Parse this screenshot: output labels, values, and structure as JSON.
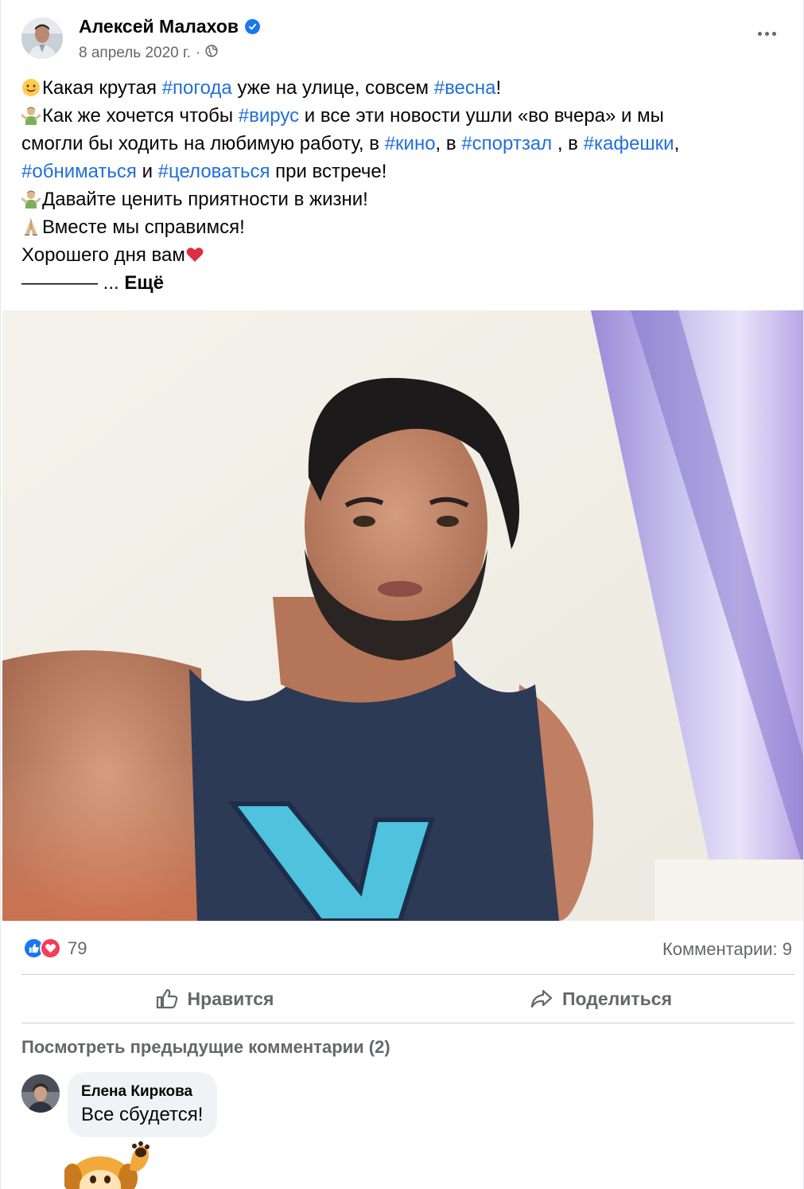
{
  "post": {
    "author": "Алексей Малахов",
    "date": "8 апрель 2020 г.",
    "separator": "·",
    "lines": {
      "l1a": "Какая крутая ",
      "l1_tag1": "#погода",
      "l1b": " уже на улице, совсем ",
      "l1_tag2": "#весна",
      "l1c": "!",
      "l2a": "Как же хочется чтобы ",
      "l2_tag": "#вирус",
      "l2b": " и все эти новости ушли «во вчера» и мы",
      "l3a": "смогли бы ходить на любимую работу, в ",
      "l3_tag1": "#кино",
      "l3b": ", в ",
      "l3_tag2": "#спортзал",
      "l3c": " , в ",
      "l3_tag3": "#кафешки",
      "l3d": ",",
      "l4_tag1": "#обниматься",
      "l4a": " и ",
      "l4_tag2": "#целоваться",
      "l4b": " при встрече!",
      "l5": "Давайте ценить приятности в жизни!",
      "l6": "Вместе мы справимся!",
      "l7": "Хорошего дня вам",
      "l8": "———— ",
      "ellipsis": "... ",
      "more": "Ещё"
    }
  },
  "reactions": {
    "count": "79",
    "comments": "Комментарии: 9"
  },
  "actions": {
    "like": "Нравится",
    "share": "Поделиться"
  },
  "comments": {
    "view_previous": "Посмотреть предыдущие комментарии (2)",
    "items": [
      {
        "author": "Елена Киркова",
        "text": "Все сбудется!"
      }
    ]
  },
  "colors": {
    "hashtag": "#216fdb",
    "verified": "#1877f2",
    "like": "#1877f2",
    "love": "#f33e58",
    "secondary_text": "#65676b"
  },
  "icons": [
    "verified-badge-icon",
    "globe-icon",
    "more-dots-icon",
    "smile-emoji-icon",
    "shrug-emoji-icon",
    "pray-emoji-icon",
    "heart-emoji-icon",
    "like-reaction-icon",
    "love-reaction-icon",
    "like-thumb-icon",
    "share-arrow-icon",
    "dog-sticker-icon"
  ]
}
